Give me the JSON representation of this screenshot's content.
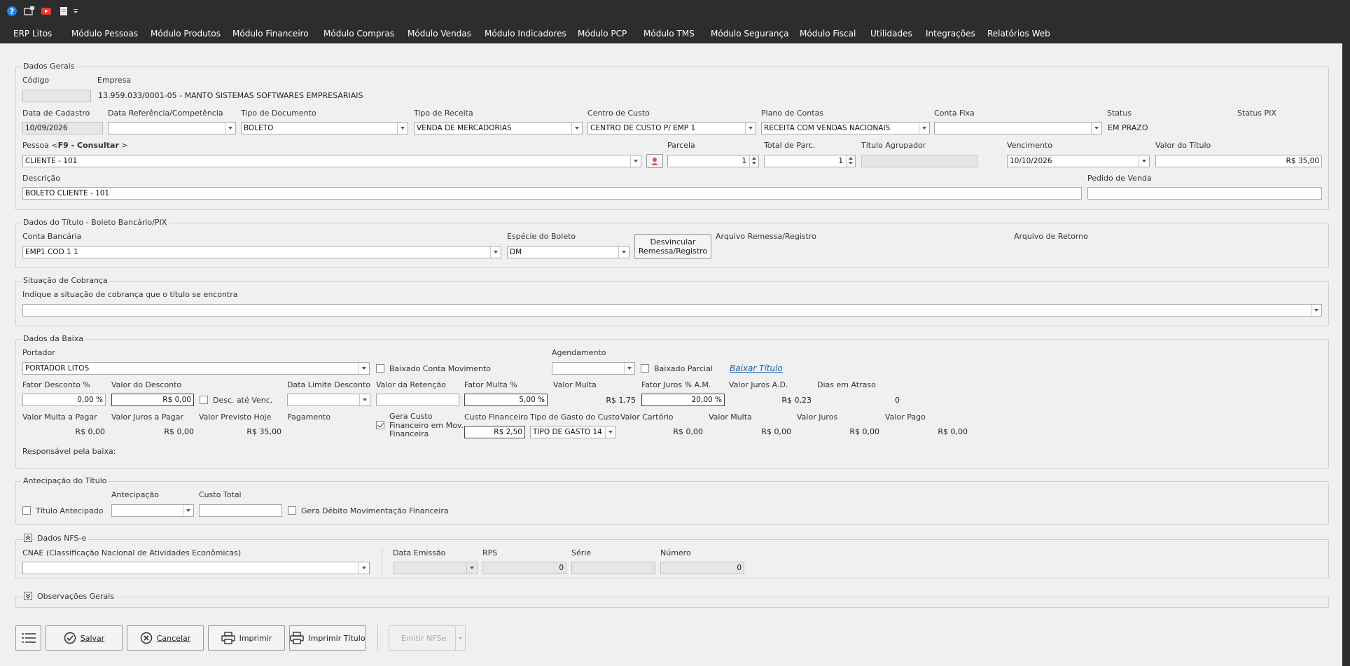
{
  "menu": [
    "ERP Litos",
    "Módulo Pessoas",
    "Módulo Produtos",
    "Módulo Financeiro",
    "Módulo Compras",
    "Módulo Vendas",
    "Módulo Indicadores",
    "Módulo PCP",
    "Módulo TMS",
    "Módulo Segurança",
    "Módulo Fiscal",
    "Utilidades",
    "Integrações",
    "Relatórios Web"
  ],
  "dados_gerais": {
    "title": "Dados Gerais",
    "codigo_label": "Código",
    "codigo_value": "",
    "empresa_label": "Empresa",
    "empresa_value": "13.959.033/0001-05 - MANTO SISTEMAS SOFTWARES EMPRESARIAIS",
    "data_cadastro_label": "Data de Cadastro",
    "data_cadastro_value": "10/09/2026",
    "data_ref_label": "Data Referência/Competência",
    "data_ref_value": "",
    "tipo_doc_label": "Tipo de Documento",
    "tipo_doc_value": "BOLETO",
    "tipo_receita_label": "Tipo de Receita",
    "tipo_receita_value": "VENDA DE MERCADORIAS",
    "centro_custo_label": "Centro de Custo",
    "centro_custo_value": "CENTRO DE CUSTO P/ EMP 1",
    "plano_contas_label": "Plano de Contas",
    "plano_contas_value": "RECEITA COM VENDAS NACIONAIS",
    "conta_fixa_label": "Conta Fixa",
    "conta_fixa_value": "",
    "status_label": "Status",
    "status_value": "EM PRAZO",
    "status_pix_label": "Status PIX",
    "pessoa_label_pre": "Pessoa <",
    "pessoa_label_bold": "F9 - Consultar",
    "pessoa_label_post": " >",
    "pessoa_value": "CLIENTE - 101",
    "parcela_label": "Parcela",
    "parcela_value": "1",
    "total_parc_label": "Total de Parc.",
    "total_parc_value": "1",
    "titulo_agrupado_label": "Título Agrupador",
    "titulo_agrupado_value": "",
    "vencimento_label": "Vencimento",
    "vencimento_value": "10/10/2026",
    "valor_titulo_label": "Valor do Título",
    "valor_titulo_value": "R$ 35,00",
    "descricao_label": "Descrição",
    "descricao_value": "BOLETO CLIENTE - 101",
    "pedido_venda_label": "Pedido de Venda",
    "pedido_venda_value": ""
  },
  "dados_titulo": {
    "title": "Dados do Título - Boleto Bancário/PIX",
    "conta_bancaria_label": "Conta Bancária",
    "conta_bancaria_value": "EMP1 COD 1 1",
    "especie_label": "Espécie do Boleto",
    "especie_value": "DM",
    "desvincular_line1": "Desvincular",
    "desvincular_line2": "Remessa/Registro",
    "arquivo_remessa_label": "Arquivo Remessa/Registro",
    "arquivo_retorno_label": "Arquivo de Retorno"
  },
  "situacao": {
    "title": "Situação de Cobrança",
    "hint": "Indique a situação de cobrança que o título se encontra",
    "value": ""
  },
  "baixa": {
    "title": "Dados da Baixa",
    "portador_label": "Portador",
    "portador_value": "PORTADOR LITOS",
    "baixado_conta_label": "Baixado Conta Movimento",
    "agendamento_label": "Agendamento",
    "agendamento_value": "",
    "baixado_parcial_label": "Baixado Parcial",
    "baixar_titulo_link": "Baixar Título",
    "fator_desconto_label": "Fator Desconto %",
    "fator_desconto_value": "0,00 %",
    "valor_desconto_label": "Valor do Desconto",
    "valor_desconto_value": "R$ 0,00",
    "desc_ate_venc_label": "Desc. até Venc.",
    "data_limite_label": "Data Limite Desconto",
    "data_limite_value": "",
    "valor_retencao_label": "Valor da Retenção",
    "valor_retencao_value": "",
    "fator_multa_label": "Fator Multa %",
    "fator_multa_value": "5,00 %",
    "valor_multa_label": "Valor Multa",
    "valor_multa_value": "R$ 1,75",
    "fator_juros_label": "Fator Juros % A.M.",
    "fator_juros_value": "20,00 %",
    "valor_juros_ad_label": "Valor Juros A.D.",
    "valor_juros_ad_value": "R$ 0,23",
    "dias_atraso_label": "Dias em Atraso",
    "dias_atraso_value": "0",
    "valor_multa_pagar_label": "Valor Multa a Pagar",
    "valor_multa_pagar_value": "R$ 0,00",
    "valor_juros_pagar_label": "Valor Juros a Pagar",
    "valor_juros_pagar_value": "R$ 0,00",
    "valor_previsto_label": "Valor Previsto Hoje",
    "valor_previsto_value": "R$ 35,00",
    "pagamento_label": "Pagamento",
    "gera_custo_line1": "Gera Custo",
    "gera_custo_line2": "Financeiro em Mov.",
    "gera_custo_line3": "Financeira",
    "custo_financeiro_label": "Custo Financeiro",
    "custo_financeiro_value": "R$ 2,50",
    "tipo_gasto_label": "Tipo de Gasto do Custo",
    "tipo_gasto_value": "TIPO DE GASTO 14",
    "valor_cartorio_label": "Valor Cartório",
    "valor_cartorio_value": "R$ 0,00",
    "valor_multa2_label": "Valor Multa",
    "valor_multa2_value": "R$ 0,00",
    "valor_juros_label": "Valor Juros",
    "valor_juros_value": "R$ 0,00",
    "valor_pago_label": "Valor Pago",
    "valor_pago_value": "R$ 0,00",
    "responsavel_label": "Responsável pela baixa:"
  },
  "antecipacao": {
    "title": "Antecipação do Título",
    "titulo_antecipado_label": "Título Antecipado",
    "antecipacao_label": "Antecipação",
    "antecipacao_value": "",
    "custo_total_label": "Custo Total",
    "custo_total_value": "",
    "gera_debito_label": "Gera Débito Movimentação Financeira"
  },
  "nfse": {
    "title": "Dados NFS-e",
    "cnae_label": "CNAE (Classificação Nacional de Atividades Econômicas)",
    "cnae_value": "",
    "data_emissao_label": "Data Emissão",
    "data_emissao_value": "",
    "rps_label": "RPS",
    "rps_value": "0",
    "serie_label": "Série",
    "serie_value": "",
    "numero_label": "Número",
    "numero_value": "0"
  },
  "observacoes": {
    "title": "Observações Gerais"
  },
  "footer": {
    "salvar": "Salvar",
    "cancelar": "Cancelar",
    "imprimir": "Imprimir",
    "imprimir_titulo": "Imprimir Título",
    "emitir_nfse": "Emitir NFSe"
  },
  "colors": {
    "chrome": "#2d2d2d",
    "background": "#f0f0f0",
    "link": "#1a5fb4"
  }
}
